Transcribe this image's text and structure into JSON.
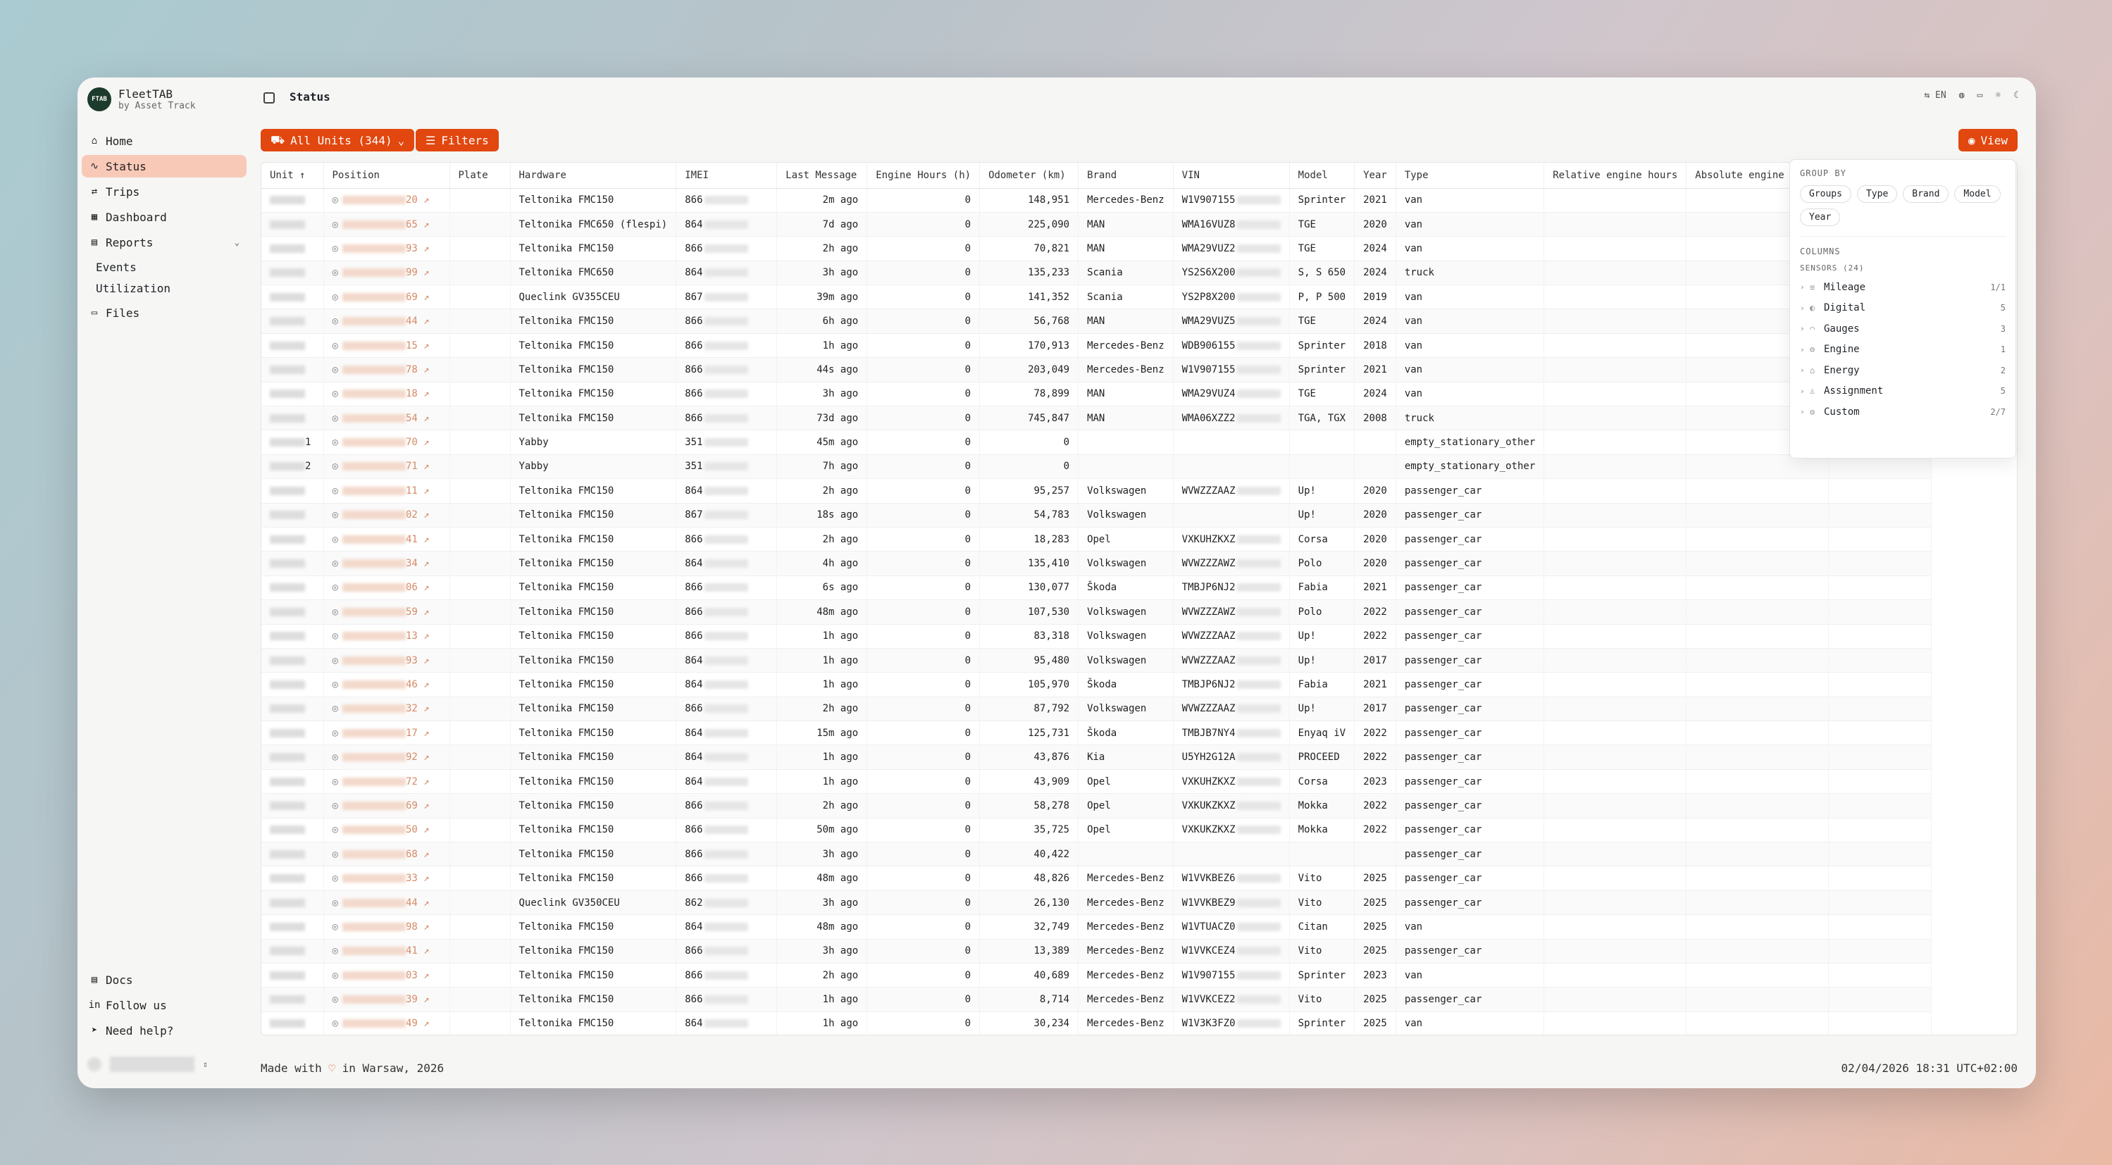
{
  "app": {
    "name": "FleetTAB",
    "subtitle": "by Asset Track",
    "logo_text": "FTAB"
  },
  "nav": {
    "items": [
      {
        "label": "Home",
        "icon": "home-icon"
      },
      {
        "label": "Status",
        "icon": "pulse-icon"
      },
      {
        "label": "Trips",
        "icon": "route-icon"
      },
      {
        "label": "Dashboard",
        "icon": "dashboard-icon"
      },
      {
        "label": "Reports",
        "icon": "reports-icon"
      }
    ],
    "sub": [
      "Events",
      "Utilization"
    ],
    "files": "Files",
    "bottom": [
      {
        "label": "Docs",
        "icon": "doc-icon"
      },
      {
        "label": "Follow us",
        "icon": "linkedin-icon"
      },
      {
        "label": "Need help?",
        "icon": "send-icon"
      }
    ]
  },
  "page": {
    "title": "Status"
  },
  "topbar": {
    "lang": "EN"
  },
  "toolbar": {
    "units": "All Units (344)",
    "filters": "Filters",
    "view": "View"
  },
  "table": {
    "columns": [
      "Unit ↑",
      "Position",
      "Plate",
      "Hardware",
      "IMEI",
      "Last Message",
      "Engine Hours (h)",
      "Odometer (km)",
      "Brand",
      "VIN",
      "Model",
      "Year",
      "Type",
      "Relative engine hours",
      "Absolute engine hours",
      "engi"
    ],
    "rows": [
      {
        "unit": "",
        "pos": "20",
        "hw": "Teltonika FMC150",
        "imei": "866",
        "last": "2m ago",
        "eh": "0",
        "odo": "148,951",
        "brand": "Mercedes-Benz",
        "vin": "W1V907155",
        "model": "Sprinter",
        "year": "2021",
        "type": "van"
      },
      {
        "unit": "",
        "pos": "65",
        "hw": "Teltonika FMC650 (flespi)",
        "imei": "864",
        "last": "7d ago",
        "eh": "0",
        "odo": "225,090",
        "brand": "MAN",
        "vin": "WMA16VUZ8",
        "model": "TGE",
        "year": "2020",
        "type": "van"
      },
      {
        "unit": "",
        "pos": "93",
        "hw": "Teltonika FMC150",
        "imei": "866",
        "last": "2h ago",
        "eh": "0",
        "odo": "70,821",
        "brand": "MAN",
        "vin": "WMA29VUZ2",
        "model": "TGE",
        "year": "2024",
        "type": "van"
      },
      {
        "unit": "",
        "pos": "99",
        "hw": "Teltonika FMC650",
        "imei": "864",
        "last": "3h ago",
        "eh": "0",
        "odo": "135,233",
        "brand": "Scania",
        "vin": "YS2S6X200",
        "model": "S, S 650",
        "year": "2024",
        "type": "truck"
      },
      {
        "unit": "",
        "pos": "69",
        "hw": "Queclink GV355CEU",
        "imei": "867",
        "last": "39m ago",
        "eh": "0",
        "odo": "141,352",
        "brand": "Scania",
        "vin": "YS2P8X200",
        "model": "P, P 500",
        "year": "2019",
        "type": "van"
      },
      {
        "unit": "",
        "pos": "44",
        "hw": "Teltonika FMC150",
        "imei": "866",
        "last": "6h ago",
        "eh": "0",
        "odo": "56,768",
        "brand": "MAN",
        "vin": "WMA29VUZ5",
        "model": "TGE",
        "year": "2024",
        "type": "van"
      },
      {
        "unit": "",
        "pos": "15",
        "hw": "Teltonika FMC150",
        "imei": "866",
        "last": "1h ago",
        "eh": "0",
        "odo": "170,913",
        "brand": "Mercedes-Benz",
        "vin": "WDB906155",
        "model": "Sprinter",
        "year": "2018",
        "type": "van"
      },
      {
        "unit": "",
        "pos": "78",
        "hw": "Teltonika FMC150",
        "imei": "866",
        "last": "44s ago",
        "eh": "0",
        "odo": "203,049",
        "brand": "Mercedes-Benz",
        "vin": "W1V907155",
        "model": "Sprinter",
        "year": "2021",
        "type": "van"
      },
      {
        "unit": "",
        "pos": "18",
        "hw": "Teltonika FMC150",
        "imei": "866",
        "last": "3h ago",
        "eh": "0",
        "odo": "78,899",
        "brand": "MAN",
        "vin": "WMA29VUZ4",
        "model": "TGE",
        "year": "2024",
        "type": "van"
      },
      {
        "unit": "",
        "pos": "54",
        "hw": "Teltonika FMC150",
        "imei": "866",
        "last": "73d ago",
        "eh": "0",
        "odo": "745,847",
        "brand": "MAN",
        "vin": "WMA06XZZ2",
        "model": "TGA, TGX",
        "year": "2008",
        "type": "truck"
      },
      {
        "unit": "1",
        "pos": "70",
        "hw": "Yabby",
        "imei": "351",
        "last": "45m ago",
        "eh": "0",
        "odo": "0",
        "brand": "",
        "vin": "",
        "model": "",
        "year": "",
        "type": "empty_stationary_other"
      },
      {
        "unit": "2",
        "pos": "71",
        "hw": "Yabby",
        "imei": "351",
        "last": "7h ago",
        "eh": "0",
        "odo": "0",
        "brand": "",
        "vin": "",
        "model": "",
        "year": "",
        "type": "empty_stationary_other"
      },
      {
        "unit": "",
        "pos": "11",
        "hw": "Teltonika FMC150",
        "imei": "864",
        "last": "2h ago",
        "eh": "0",
        "odo": "95,257",
        "brand": "Volkswagen",
        "vin": "WVWZZZAAZ",
        "model": "Up!",
        "year": "2020",
        "type": "passenger_car"
      },
      {
        "unit": "",
        "pos": "02",
        "hw": "Teltonika FMC150",
        "imei": "867",
        "last": "18s ago",
        "eh": "0",
        "odo": "54,783",
        "brand": "Volkswagen",
        "vin": "",
        "model": "Up!",
        "year": "2020",
        "type": "passenger_car"
      },
      {
        "unit": "",
        "pos": "41",
        "hw": "Teltonika FMC150",
        "imei": "866",
        "last": "2h ago",
        "eh": "0",
        "odo": "18,283",
        "brand": "Opel",
        "vin": "VXKUHZKXZ",
        "model": "Corsa",
        "year": "2020",
        "type": "passenger_car"
      },
      {
        "unit": "",
        "pos": "34",
        "hw": "Teltonika FMC150",
        "imei": "864",
        "last": "4h ago",
        "eh": "0",
        "odo": "135,410",
        "brand": "Volkswagen",
        "vin": "WVWZZZAWZ",
        "model": "Polo",
        "year": "2020",
        "type": "passenger_car"
      },
      {
        "unit": "",
        "pos": "06",
        "hw": "Teltonika FMC150",
        "imei": "866",
        "last": "6s ago",
        "eh": "0",
        "odo": "130,077",
        "brand": "Škoda",
        "vin": "TMBJP6NJ2",
        "model": "Fabia",
        "year": "2021",
        "type": "passenger_car"
      },
      {
        "unit": "",
        "pos": "59",
        "hw": "Teltonika FMC150",
        "imei": "866",
        "last": "48m ago",
        "eh": "0",
        "odo": "107,530",
        "brand": "Volkswagen",
        "vin": "WVWZZZAWZ",
        "model": "Polo",
        "year": "2022",
        "type": "passenger_car"
      },
      {
        "unit": "",
        "pos": "13",
        "hw": "Teltonika FMC150",
        "imei": "866",
        "last": "1h ago",
        "eh": "0",
        "odo": "83,318",
        "brand": "Volkswagen",
        "vin": "WVWZZZAAZ",
        "model": "Up!",
        "year": "2022",
        "type": "passenger_car"
      },
      {
        "unit": "",
        "pos": "93",
        "hw": "Teltonika FMC150",
        "imei": "864",
        "last": "1h ago",
        "eh": "0",
        "odo": "95,480",
        "brand": "Volkswagen",
        "vin": "WVWZZZAAZ",
        "model": "Up!",
        "year": "2017",
        "type": "passenger_car"
      },
      {
        "unit": "",
        "pos": "46",
        "hw": "Teltonika FMC150",
        "imei": "864",
        "last": "1h ago",
        "eh": "0",
        "odo": "105,970",
        "brand": "Škoda",
        "vin": "TMBJP6NJ2",
        "model": "Fabia",
        "year": "2021",
        "type": "passenger_car"
      },
      {
        "unit": "",
        "pos": "32",
        "hw": "Teltonika FMC150",
        "imei": "866",
        "last": "2h ago",
        "eh": "0",
        "odo": "87,792",
        "brand": "Volkswagen",
        "vin": "WVWZZZAAZ",
        "model": "Up!",
        "year": "2017",
        "type": "passenger_car"
      },
      {
        "unit": "",
        "pos": "17",
        "hw": "Teltonika FMC150",
        "imei": "864",
        "last": "15m ago",
        "eh": "0",
        "odo": "125,731",
        "brand": "Škoda",
        "vin": "TMBJB7NY4",
        "model": "Enyaq iV",
        "year": "2022",
        "type": "passenger_car"
      },
      {
        "unit": "",
        "pos": "92",
        "hw": "Teltonika FMC150",
        "imei": "864",
        "last": "1h ago",
        "eh": "0",
        "odo": "43,876",
        "brand": "Kia",
        "vin": "U5YH2G12A",
        "model": "PROCEED",
        "year": "2022",
        "type": "passenger_car"
      },
      {
        "unit": "",
        "pos": "72",
        "hw": "Teltonika FMC150",
        "imei": "864",
        "last": "1h ago",
        "eh": "0",
        "odo": "43,909",
        "brand": "Opel",
        "vin": "VXKUHZKXZ",
        "model": "Corsa",
        "year": "2023",
        "type": "passenger_car"
      },
      {
        "unit": "",
        "pos": "69",
        "hw": "Teltonika FMC150",
        "imei": "866",
        "last": "2h ago",
        "eh": "0",
        "odo": "58,278",
        "brand": "Opel",
        "vin": "VXKUKZKXZ",
        "model": "Mokka",
        "year": "2022",
        "type": "passenger_car"
      },
      {
        "unit": "",
        "pos": "50",
        "hw": "Teltonika FMC150",
        "imei": "866",
        "last": "50m ago",
        "eh": "0",
        "odo": "35,725",
        "brand": "Opel",
        "vin": "VXKUKZKXZ",
        "model": "Mokka",
        "year": "2022",
        "type": "passenger_car"
      },
      {
        "unit": "",
        "pos": "68",
        "hw": "Teltonika FMC150",
        "imei": "866",
        "last": "3h ago",
        "eh": "0",
        "odo": "40,422",
        "brand": "",
        "vin": "",
        "model": "",
        "year": "",
        "type": "passenger_car"
      },
      {
        "unit": "",
        "pos": "33",
        "hw": "Teltonika FMC150",
        "imei": "866",
        "last": "48m ago",
        "eh": "0",
        "odo": "48,826",
        "brand": "Mercedes-Benz",
        "vin": "W1VVKBEZ6",
        "model": "Vito",
        "year": "2025",
        "type": "passenger_car"
      },
      {
        "unit": "",
        "pos": "44",
        "hw": "Queclink GV350CEU",
        "imei": "862",
        "last": "3h ago",
        "eh": "0",
        "odo": "26,130",
        "brand": "Mercedes-Benz",
        "vin": "W1VVKBEZ9",
        "model": "Vito",
        "year": "2025",
        "type": "passenger_car"
      },
      {
        "unit": "",
        "pos": "98",
        "hw": "Teltonika FMC150",
        "imei": "864",
        "last": "48m ago",
        "eh": "0",
        "odo": "32,749",
        "brand": "Mercedes-Benz",
        "vin": "W1VTUACZ0",
        "model": "Citan",
        "year": "2025",
        "type": "van"
      },
      {
        "unit": "",
        "pos": "41",
        "hw": "Teltonika FMC150",
        "imei": "866",
        "last": "3h ago",
        "eh": "0",
        "odo": "13,389",
        "brand": "Mercedes-Benz",
        "vin": "W1VVKCEZ4",
        "model": "Vito",
        "year": "2025",
        "type": "passenger_car"
      },
      {
        "unit": "",
        "pos": "03",
        "hw": "Teltonika FMC150",
        "imei": "866",
        "last": "2h ago",
        "eh": "0",
        "odo": "40,689",
        "brand": "Mercedes-Benz",
        "vin": "W1V907155",
        "model": "Sprinter",
        "year": "2023",
        "type": "van"
      },
      {
        "unit": "",
        "pos": "39",
        "hw": "Teltonika FMC150",
        "imei": "866",
        "last": "1h ago",
        "eh": "0",
        "odo": "8,714",
        "brand": "Mercedes-Benz",
        "vin": "W1VVKCEZ2",
        "model": "Vito",
        "year": "2025",
        "type": "passenger_car"
      },
      {
        "unit": "",
        "pos": "49",
        "hw": "Teltonika FMC150",
        "imei": "864",
        "last": "1h ago",
        "eh": "0",
        "odo": "30,234",
        "brand": "Mercedes-Benz",
        "vin": "W1V3K3FZ0",
        "model": "Sprinter",
        "year": "2025",
        "type": "van"
      }
    ]
  },
  "view_panel": {
    "group_by_title": "GROUP BY",
    "group_by": [
      "Groups",
      "Type",
      "Brand",
      "Model",
      "Year"
    ],
    "columns_title": "COLUMNS",
    "sensors_title": "SENSORS (24)",
    "sensors": [
      {
        "name": "Mileage",
        "count": "1/1"
      },
      {
        "name": "Digital",
        "count": "5"
      },
      {
        "name": "Gauges",
        "count": "3"
      },
      {
        "name": "Engine",
        "count": "1"
      },
      {
        "name": "Energy",
        "count": "2"
      },
      {
        "name": "Assignment",
        "count": "5"
      },
      {
        "name": "Custom",
        "count": "2/7"
      }
    ]
  },
  "footer": {
    "made_with": "Made with",
    "in_city": "in Warsaw, 2026",
    "datetime": "02/04/2026 18:31 UTC+02:00"
  }
}
